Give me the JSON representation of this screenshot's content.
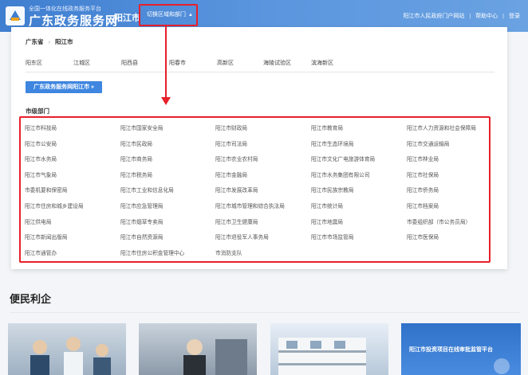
{
  "header": {
    "logo_sub": "全国一体化在线政务服务平台",
    "logo_main": "广东政务服务网",
    "city": "阳江市",
    "switch_label": "切换区域和部门",
    "links": [
      "阳江市人民政府门户网站",
      "帮助中心",
      "登录"
    ]
  },
  "panel": {
    "breadcrumb": [
      "广东省",
      "阳江市"
    ],
    "districts": [
      "阳东区",
      "江城区",
      "阳西县",
      "阳春市",
      "高新区",
      "海陵试验区",
      "滨海新区"
    ],
    "portal_button": "广东政务服务网阳江市 »",
    "dept_title": "市级部门",
    "departments": [
      [
        "阳江市科技局",
        "阳江市国家安全局",
        "阳江市财政局",
        "阳江市教育局",
        "阳江市人力资源和社会保障局"
      ],
      [
        "阳江市公安局",
        "阳江市民政局",
        "阳江市司法局",
        "阳江市生态环境局",
        "阳江市交通运输局"
      ],
      [
        "阳江市水务局",
        "阳江市商务局",
        "阳江市农业农村局",
        "阳江市文化广电旅游体育局",
        "阳江市林业局"
      ],
      [
        "阳江市气象局",
        "阳江市税务局",
        "阳江市金融局",
        "阳江市水务集团有限公司",
        "阳江市社保局"
      ],
      [
        "市委机要和保密局",
        "阳江市工业和信息化局",
        "阳江市发展改革局",
        "阳江市民族宗教局",
        "阳江市侨务局"
      ],
      [
        "阳江市住房和城乡建设局",
        "阳江市应急管理局",
        "阳江市城市管理和综合执法局",
        "阳江市统计局",
        "阳江市档案局"
      ],
      [
        "阳江供电局",
        "阳江市烟草专卖局",
        "阳江市卫生健康局",
        "阳江市地震局",
        "市委组织部（市公务员局）"
      ],
      [
        "阳江市新闻出版局",
        "阳江市自然资源局",
        "阳江市退役军人事务局",
        "阳江市市场监管局",
        "阳江市医保局"
      ],
      [
        "阳江市通管办",
        "阳江市住房公积金管理中心",
        "市消防支队"
      ]
    ]
  },
  "section": {
    "title": "便民利企",
    "card4_caption": "阳江市投资项目在线审批监管平台"
  },
  "colors": {
    "header_blue": "#4a88d8",
    "annotation_red": "#e8202a",
    "button_blue": "#3e86e0"
  }
}
